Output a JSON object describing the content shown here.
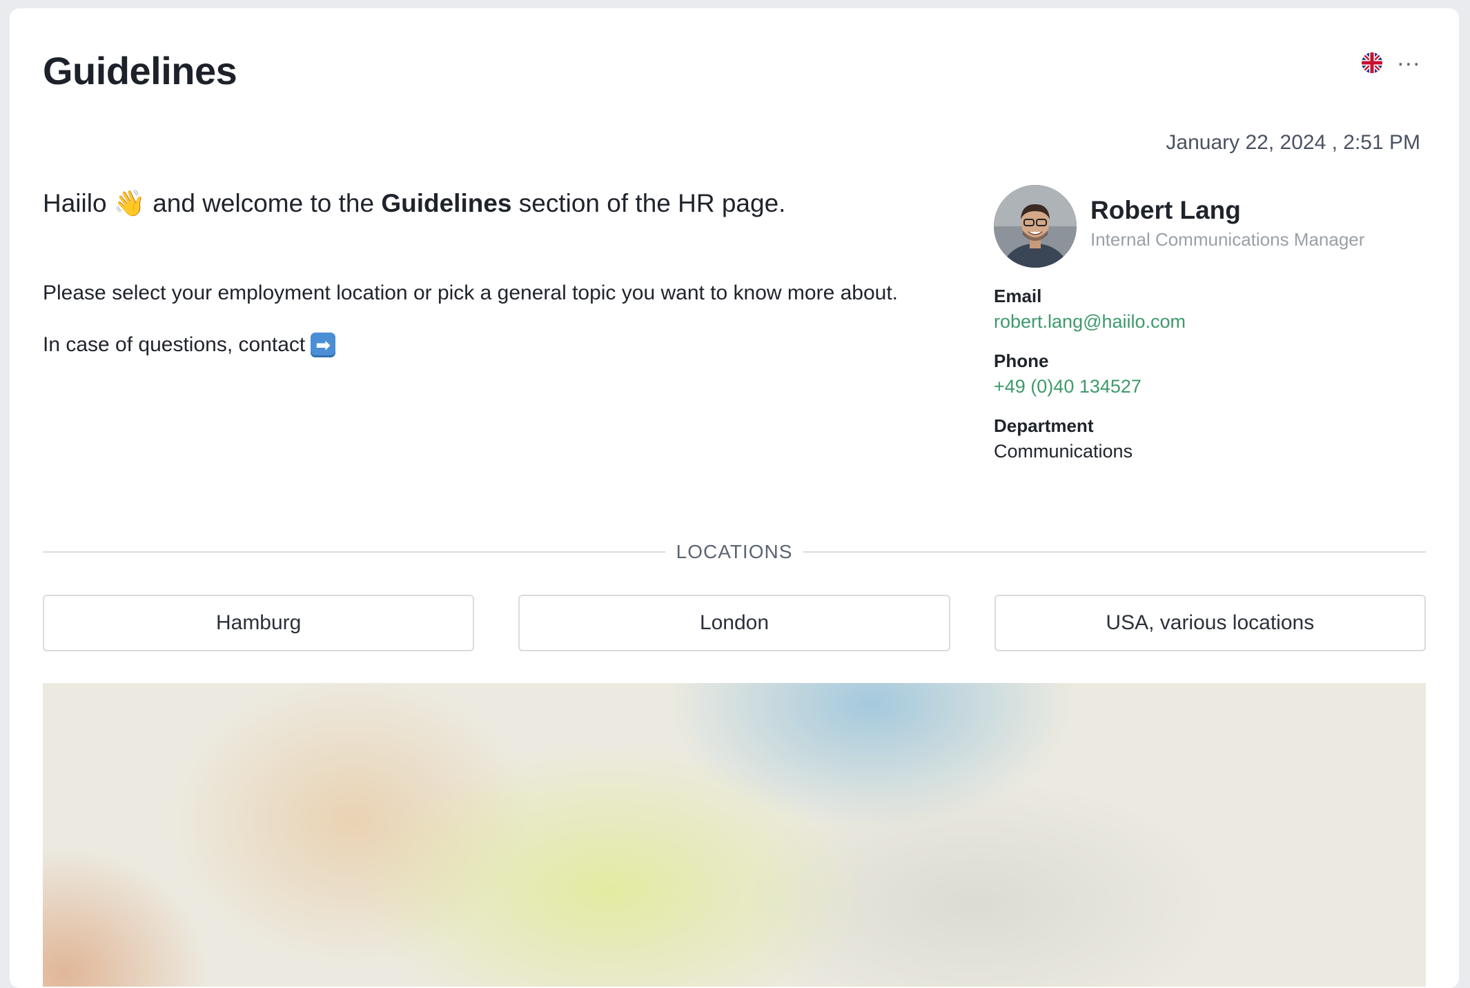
{
  "header": {
    "title": "Guidelines",
    "language_icon": "uk-flag-icon",
    "more_label": "..."
  },
  "meta": {
    "date": "January 22, 2024 , 2:51 PM"
  },
  "intro": {
    "greeting_start": "Haiilo",
    "wave_emoji": "👋",
    "greeting_mid": "and welcome to the",
    "greeting_bold": "Guidelines",
    "greeting_end": "section of the HR page.",
    "paragraph_1": "Please select your employment location or pick a general topic you want to know more about.",
    "paragraph_2": "In case of questions, contact",
    "arrow_emoji": "➡"
  },
  "contact": {
    "name": "Robert Lang",
    "role": "Internal Communications Manager",
    "email_label": "Email",
    "email": "robert.lang@haiilo.com",
    "phone_label": "Phone",
    "phone": "+49 (0)40 134527",
    "department_label": "Department",
    "department": "Communications"
  },
  "locations": {
    "heading": "LOCATIONS",
    "items": [
      "Hamburg",
      "London",
      "USA, various locations"
    ]
  },
  "colors": {
    "link": "#3d9a6a",
    "background": "#e9ebef",
    "card": "#ffffff"
  }
}
